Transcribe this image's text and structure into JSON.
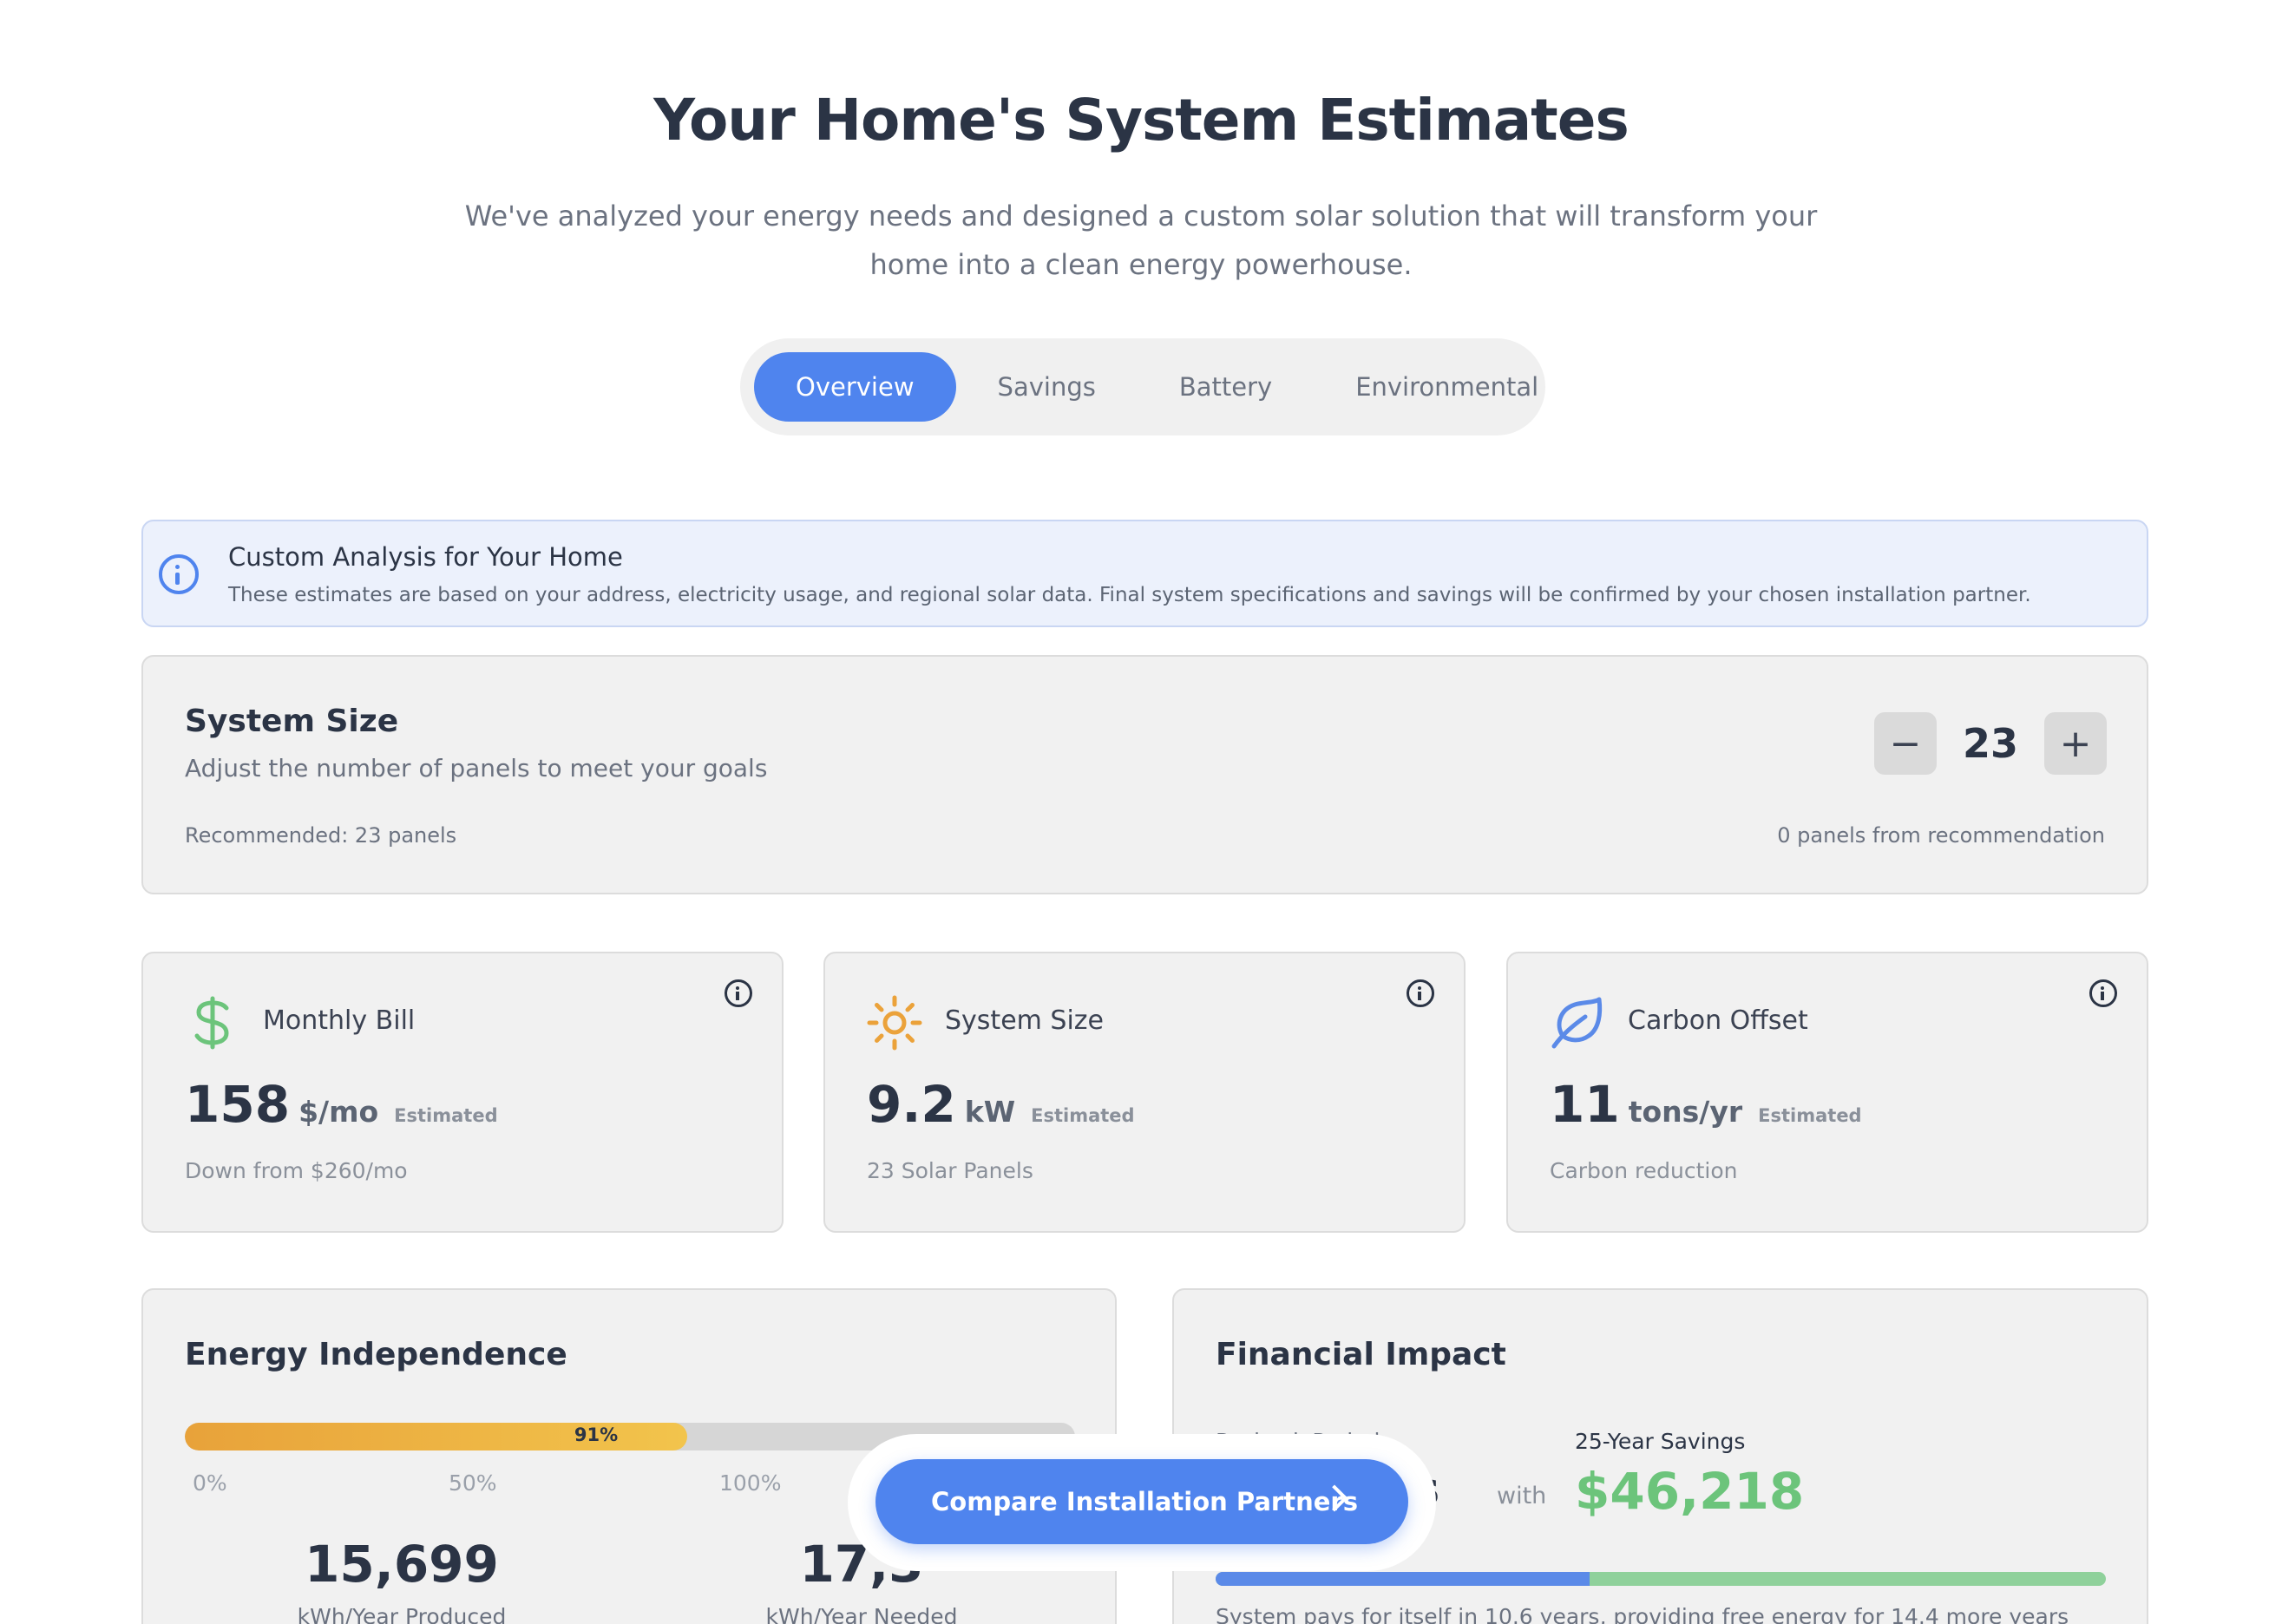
{
  "hero": {
    "title": "Your Home's System Estimates",
    "subtitle": "We've analyzed your energy needs and designed a custom solar solution that will transform your home into a clean energy powerhouse."
  },
  "tabs": [
    {
      "label": "Overview",
      "active": true
    },
    {
      "label": "Savings",
      "active": false
    },
    {
      "label": "Battery",
      "active": false
    },
    {
      "label": "Environmental",
      "active": false
    }
  ],
  "notice": {
    "icon": "info-icon",
    "title": "Custom Analysis for Your Home",
    "text": "These estimates are based on your address, electricity usage, and regional solar data. Final system specifications and savings will be confirmed by your chosen installation partner."
  },
  "system_size": {
    "title": "System Size",
    "subtitle": "Adjust the number of panels to meet your goals",
    "recommended": "Recommended: 23 panels",
    "difference": "0 panels from recommendation",
    "value": "23",
    "minus": "−",
    "plus": "+"
  },
  "stats": [
    {
      "label": "Monthly Bill",
      "value": "158",
      "unit": "$/mo",
      "badge": "Estimated",
      "foot": "Down from $260/mo",
      "icon": "dollar-icon",
      "color": "#6cc47b"
    },
    {
      "label": "System Size",
      "value": "9.2",
      "unit": "kW",
      "badge": "Estimated",
      "foot": "23 Solar Panels",
      "icon": "sun-icon",
      "color": "#eba23a"
    },
    {
      "label": "Carbon Offset",
      "value": "11",
      "unit": "tons/yr",
      "badge": "Estimated",
      "foot": "Carbon reduction",
      "icon": "leaf-icon",
      "color": "#5b8ae8"
    }
  ],
  "energy": {
    "title": "Energy Independence",
    "percent": 91,
    "percent_label": "91%",
    "scale": [
      "0%",
      "50%",
      "100%"
    ],
    "produced": "15,699",
    "produced_label": "kWh/Year Produced",
    "needed": "17,3",
    "needed_label": "kWh/Year Needed"
  },
  "financial": {
    "title": "Financial Impact",
    "payback_label": "Payback Period",
    "payback_value": "es",
    "with": "with",
    "savings_label": "25-Year Savings",
    "savings_value": "$46,218",
    "payback_fraction": 0.42,
    "note": "System pays for itself in 10.6 years, providing free energy for 14.4 more years"
  },
  "cta": {
    "label": "Compare Installation Partners"
  },
  "colors": {
    "accent": "#4f84ee",
    "green": "#6cc47b",
    "amber": "#eba23a"
  }
}
